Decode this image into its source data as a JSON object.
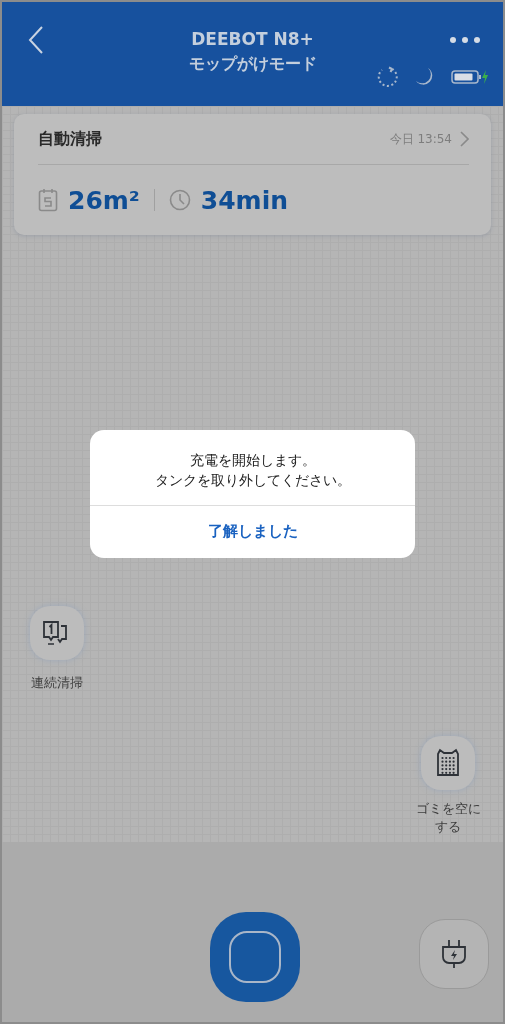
{
  "header": {
    "title": "DEEBOT N8+",
    "subtitle": "モップがけモード"
  },
  "record": {
    "mode": "自動清掃",
    "time": "今日 13:54",
    "area": "26m²",
    "duration": "34min"
  },
  "side_buttons": [
    {
      "label": "連続清掃",
      "kind": "continuous"
    },
    {
      "label": "ゴミを空にする",
      "kind": "empty"
    }
  ],
  "dialog": {
    "message_lines": [
      "充電を開始します。",
      "タンクを取り外してください。"
    ],
    "button": "了解しました"
  }
}
